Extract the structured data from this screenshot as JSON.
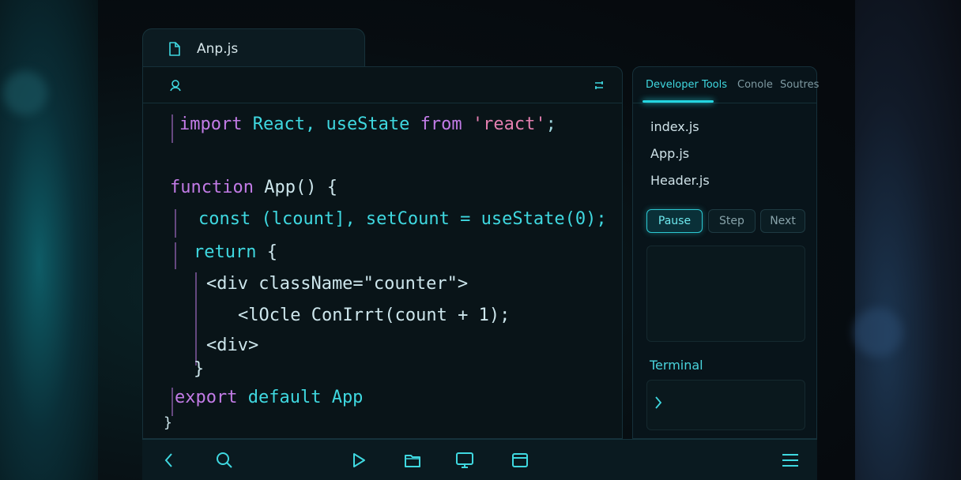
{
  "editor": {
    "file_tab": "Anp.js",
    "code": {
      "l1": {
        "kw": "import",
        "id": "React, useState",
        "from": "from",
        "str": "'react'",
        "end": ";"
      },
      "l2": {
        "kw": "function",
        "id": "App() {"
      },
      "l3": {
        "kw": "const",
        "id": "(lcount], setCount = useState(0);"
      },
      "l4": {
        "kw": "return",
        "id": "{"
      },
      "l5": {
        "txt": "<div className=\"counter\">"
      },
      "l6": {
        "txt": "<lOcle ConIrrt(count + 1);"
      },
      "l7": {
        "txt": "<div>"
      },
      "l8": {
        "txt": "}"
      },
      "l9": {
        "kw": "export",
        "id": "default App"
      },
      "l10": {
        "txt": "}"
      }
    }
  },
  "devtools": {
    "tabs": [
      "Developer Tools",
      "Conole",
      "Soutres"
    ],
    "files": [
      "index.js",
      "App.js",
      "Header.js"
    ],
    "controls": {
      "pause": "Pause",
      "step": "Step",
      "next": "Next"
    },
    "terminal_label": "Terminal"
  },
  "toolbar": {
    "icons": [
      "back-icon",
      "search-icon",
      "play-icon",
      "folder-icon",
      "monitor-icon",
      "window-icon",
      "menu-icon"
    ]
  },
  "colors": {
    "accent": "#25d5e0",
    "keyword": "#c27be6",
    "identifier": "#3fd8e0",
    "string": "#e47fb0"
  }
}
